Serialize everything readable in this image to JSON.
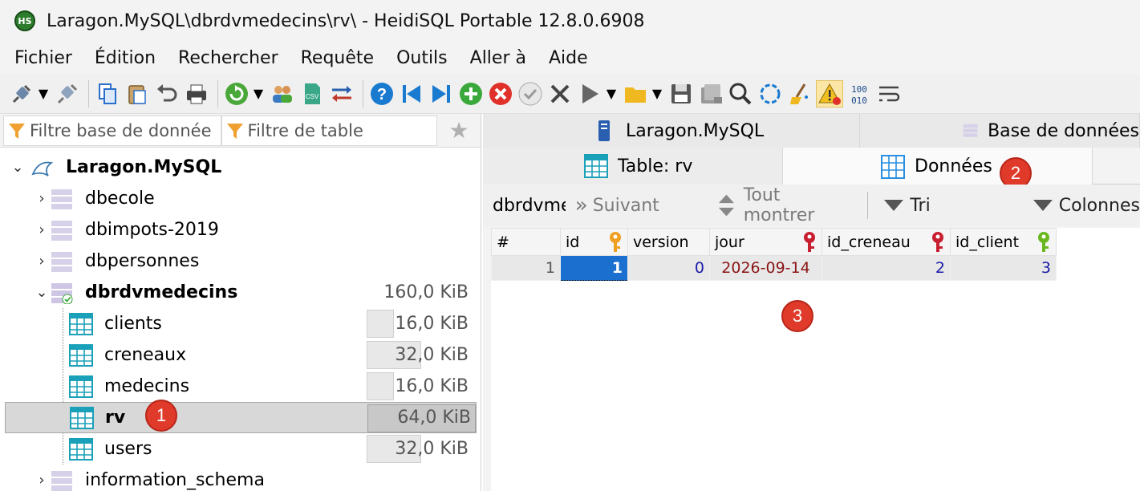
{
  "window": {
    "icon_text": "HS",
    "title": "Laragon.MySQL\\dbrdvmedecins\\rv\\ - HeidiSQL Portable 12.8.0.6908"
  },
  "menu": [
    "Fichier",
    "Édition",
    "Rechercher",
    "Requête",
    "Outils",
    "Aller à",
    "Aide"
  ],
  "toolbar": {
    "icons": [
      "connect-icon",
      "disconnect-icon",
      "copy-icon",
      "paste-icon",
      "undo-icon",
      "print-icon",
      "refresh-icon",
      "users-icon",
      "csv-export-icon",
      "transfer-icon",
      "help-icon",
      "first-icon",
      "last-icon",
      "add-icon",
      "cancel-icon",
      "apply-icon",
      "delete-icon",
      "run-icon",
      "open-folder-icon",
      "save-icon",
      "save-all-icon",
      "search-icon",
      "reload-icon",
      "clean-icon",
      "warning-icon",
      "binary-icon",
      "wrap-icon"
    ]
  },
  "filters": {
    "db_placeholder": "Filtre base de donnée",
    "table_placeholder": "Filtre de table"
  },
  "tree": {
    "root": "Laragon.MySQL",
    "databases": [
      {
        "name": "dbecole"
      },
      {
        "name": "dbimpots-2019"
      },
      {
        "name": "dbpersonnes"
      },
      {
        "name": "dbrdvmedecins",
        "size": "160,0 KiB"
      },
      {
        "name": "information_schema"
      }
    ],
    "tables": [
      {
        "name": "clients",
        "size": "16,0 KiB",
        "fill": 0.25
      },
      {
        "name": "creneaux",
        "size": "32,0 KiB",
        "fill": 0.5
      },
      {
        "name": "medecins",
        "size": "16,0 KiB",
        "fill": 0.25
      },
      {
        "name": "rv",
        "size": "64,0 KiB",
        "fill": 1.0
      },
      {
        "name": "users",
        "size": "32,0 KiB",
        "fill": 0.5
      }
    ]
  },
  "tabs": {
    "host": "Laragon.MySQL",
    "database": "Base de données",
    "table": "Table: rv",
    "data": "Données"
  },
  "databar": {
    "db_name": "dbrdvmedecins",
    "next": "Suivant",
    "show_all": "Tout montrer",
    "sort": "Tri",
    "columns": "Colonnes"
  },
  "grid": {
    "headers": [
      "#",
      "id",
      "version",
      "jour",
      "id_creneau",
      "id_client"
    ],
    "rows": [
      {
        "rownum": "1",
        "id": "1",
        "version": "0",
        "jour": "2026-09-14",
        "id_creneau": "2",
        "id_client": "3"
      }
    ]
  },
  "badges": [
    "1",
    "2",
    "3"
  ],
  "colors": {
    "badge": "#e03a2a",
    "selection": "#1a6fcf",
    "primary_key": "#f0a020",
    "foreign_key": "#c82030",
    "unique_key": "#6ab820"
  }
}
